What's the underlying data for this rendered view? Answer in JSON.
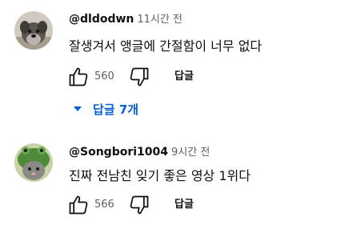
{
  "comments": [
    {
      "author": "@dldodwn",
      "time": "11시간 전",
      "text": "잘생겨서 앵글에 간절함이 너무 없다",
      "likes": "560",
      "reply_label": "답글",
      "replies_label": "답글 7개",
      "avatar_icon": "schnauzer-dog-avatar"
    },
    {
      "author": "@Songbori1004",
      "time": "9시간 전",
      "text": "진짜 전남친 잊기 좋은 영상 1위다",
      "likes": "566",
      "reply_label": "답글",
      "avatar_icon": "frog-hat-cat-avatar"
    }
  ],
  "colors": {
    "link_blue": "#065fd4",
    "secondary_text": "#606060",
    "primary_text": "#0f0f0f"
  },
  "icons": {
    "like": "thumbs-up-icon",
    "dislike": "thumbs-down-icon",
    "expand": "caret-down-icon"
  }
}
